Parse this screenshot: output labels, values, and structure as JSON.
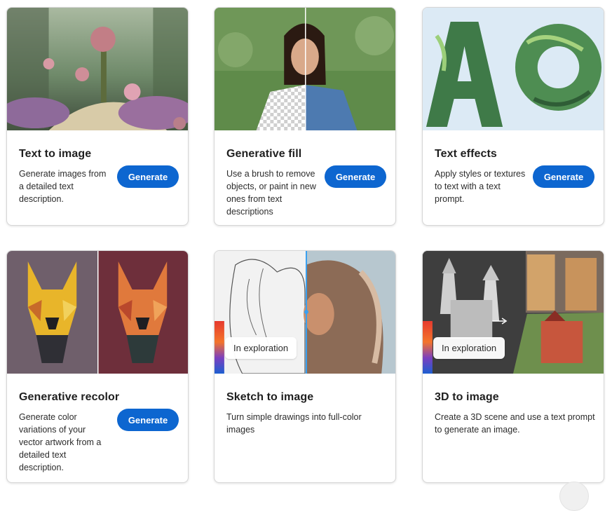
{
  "cards": [
    {
      "title": "Text to image",
      "description": "Generate images from a detailed text description.",
      "button_label": "Generate",
      "image_alt": "fantasy garden with pink flowers"
    },
    {
      "title": "Generative fill",
      "description": "Use a brush to remove objects, or paint in new ones from text descriptions",
      "button_label": "Generate",
      "image_alt": "woman in denim jacket with transparent background patch"
    },
    {
      "title": "Text effects",
      "description": "Apply styles or textures to text with a text prompt.",
      "button_label": "Generate",
      "image_alt": "letters made of tropical leaves"
    },
    {
      "title": "Generative recolor",
      "description": "Generate color variations of your vector artwork from a detailed text description.",
      "button_label": "Generate",
      "image_alt": "geometric dog vector art recolored"
    },
    {
      "title": "Sketch to image",
      "description": "Turn simple drawings into full-color images",
      "badge": "In exploration",
      "image_alt": "sketch of woman turned into full color portrait"
    },
    {
      "title": "3D to image",
      "description": "Create a 3D scene and use a text prompt to generate an image.",
      "badge": "In exploration",
      "image_alt": "3D castle shapes turned into gingerbread castle"
    }
  ],
  "colors": {
    "button_blue": "#0d66d0",
    "card_border": "#d6d6d6"
  }
}
